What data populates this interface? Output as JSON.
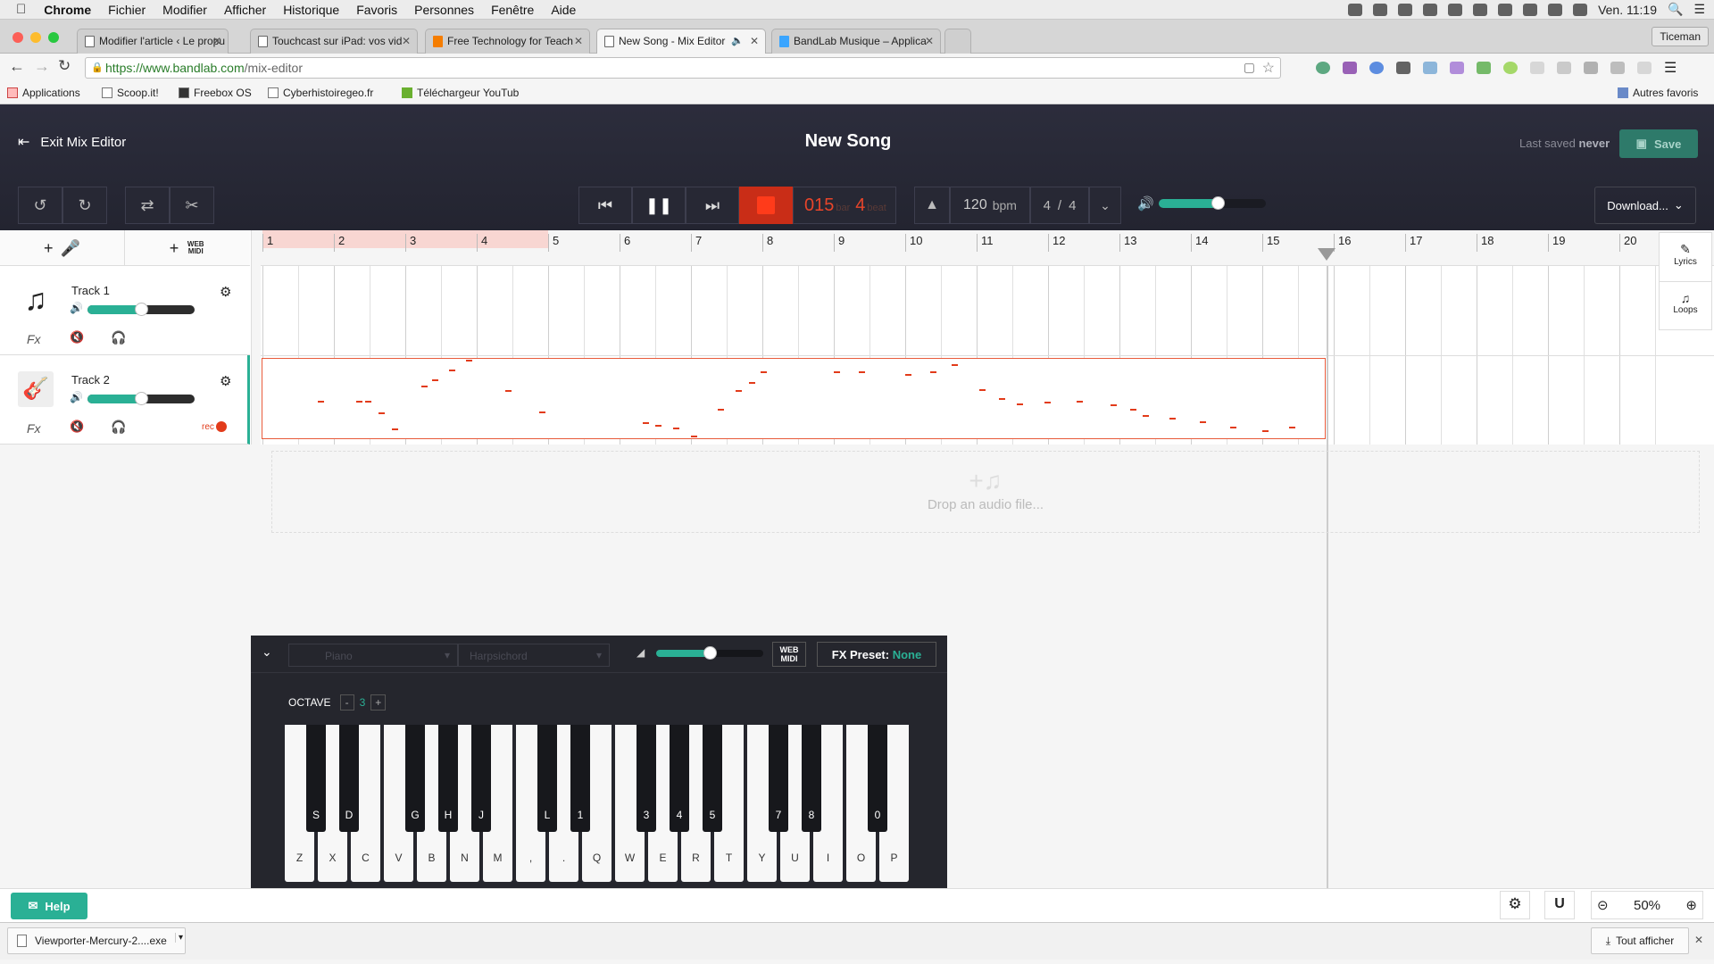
{
  "menubar": {
    "items": [
      "Chrome",
      "Fichier",
      "Modifier",
      "Afficher",
      "Historique",
      "Favoris",
      "Personnes",
      "Fenêtre",
      "Aide"
    ],
    "clock": "Ven. 11:19"
  },
  "tabs": [
    {
      "title": "Modifier l'article ‹ Le propu"
    },
    {
      "title": "Touchcast sur iPad: vos vid"
    },
    {
      "title": "Free Technology for Teach"
    },
    {
      "title": "New Song - Mix Editor"
    },
    {
      "title": "BandLab Musique – Applica"
    }
  ],
  "profile": "Ticeman",
  "address": {
    "host": "https://www.bandlab.com",
    "path": "/mix-editor"
  },
  "bookmarks": [
    "Applications",
    "Scoop.it!",
    "Freebox OS",
    "Cyberhistoiregeo.fr",
    "Téléchargeur YouTub"
  ],
  "other_bookmarks": "Autres favoris",
  "app": {
    "exit_label": "Exit Mix Editor",
    "song_title": "New Song",
    "last_saved_prefix": "Last saved",
    "last_saved_value": "never",
    "save_label": "Save",
    "counter_bar": "015",
    "counter_bar_unit": "bar",
    "counter_beat": "4",
    "counter_beat_unit": "beat",
    "tempo": "120",
    "tempo_unit": "bpm",
    "time_sig_num": "4",
    "time_sig_sep": "/",
    "time_sig_den": "4",
    "master_volume": 0.55,
    "download_label": "Download...",
    "web_midi": "WEB MIDI"
  },
  "ruler": [
    "1",
    "2",
    "3",
    "4",
    "5",
    "6",
    "7",
    "8",
    "9",
    "10",
    "11",
    "12",
    "13",
    "14",
    "15",
    "16",
    "17",
    "18",
    "19",
    "20"
  ],
  "tracks": [
    {
      "name": "Track 1",
      "volume": 0.5,
      "fx": "Fx",
      "icon": "music-note-icon"
    },
    {
      "name": "Track 2",
      "volume": 0.5,
      "fx": "Fx",
      "icon": "guitar-icon",
      "rec": "rec"
    }
  ],
  "side_panel": {
    "lyrics": "Lyrics",
    "loops": "Loops"
  },
  "dropzone": "Drop an audio file...",
  "keyboard": {
    "instrument": "Piano",
    "preset": "Harpsichord",
    "volume": 0.5,
    "fx_label": "FX Preset:",
    "fx_value": "None",
    "octave_label": "OCTAVE",
    "octave_minus": "-",
    "octave_value": "3",
    "octave_plus": "+",
    "white_keys": [
      "Z",
      "X",
      "C",
      "V",
      "B",
      "N",
      "M",
      ",",
      ".",
      "Q",
      "W",
      "E",
      "R",
      "T",
      "Y",
      "U",
      "I",
      "O",
      "P"
    ],
    "black_keys": [
      "S",
      "D",
      "G",
      "H",
      "J",
      "L",
      "1",
      "3",
      "4",
      "5",
      "7",
      "8",
      "0"
    ]
  },
  "help_label": "Help",
  "zoom": "50%",
  "download_shelf": {
    "file": "Viewporter-Mercury-2....exe",
    "show_all": "Tout afficher"
  },
  "colors": {
    "accent": "#2ab095",
    "record": "#e23b1a",
    "header": "#262733"
  }
}
